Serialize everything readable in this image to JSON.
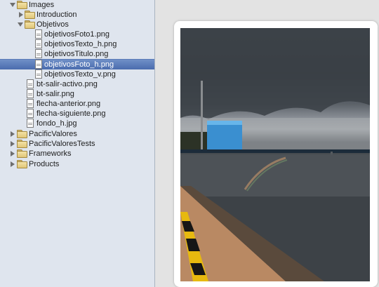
{
  "sidebar": {
    "items": [
      {
        "label": "Images",
        "kind": "folder",
        "state": "expanded"
      },
      {
        "label": "Introduction",
        "kind": "folder",
        "state": "collapsed"
      },
      {
        "label": "Objetivos",
        "kind": "folder",
        "state": "expanded"
      },
      {
        "label": "objetivosFoto1.png",
        "kind": "file"
      },
      {
        "label": "objetivosTexto_h.png",
        "kind": "file"
      },
      {
        "label": "objetivosTitulo.png",
        "kind": "file"
      },
      {
        "label": "objetivosFoto_h.png",
        "kind": "file",
        "selected": true
      },
      {
        "label": "objetivosTexto_v.png",
        "kind": "file"
      },
      {
        "label": "bt-salir-activo.png",
        "kind": "file"
      },
      {
        "label": "bt-salir.png",
        "kind": "file"
      },
      {
        "label": "flecha-anterior.png",
        "kind": "file"
      },
      {
        "label": "flecha-siguiente.png",
        "kind": "file"
      },
      {
        "label": "fondo_h.jpg",
        "kind": "file"
      },
      {
        "label": "PacificValores",
        "kind": "folder",
        "state": "collapsed"
      },
      {
        "label": "PacificValoresTests",
        "kind": "folder",
        "state": "collapsed"
      },
      {
        "label": "Frameworks",
        "kind": "folder",
        "state": "collapsed"
      },
      {
        "label": "Products",
        "kind": "folder",
        "state": "collapsed"
      }
    ]
  },
  "preview": {
    "image": "harbor-rainbow-photo"
  },
  "colors": {
    "selection": "#4a6cae",
    "sidebar_bg": "#dfe5ee",
    "folder": "#e0c679"
  }
}
